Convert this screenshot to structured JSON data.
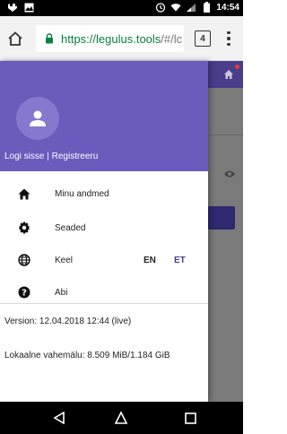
{
  "status_bar": {
    "time": "14:54",
    "left_icons": [
      "usb-icon",
      "image-icon"
    ],
    "right_icons": [
      "alarm-icon",
      "wifi-icon",
      "signal-icon",
      "battery-icon"
    ]
  },
  "browser": {
    "url_main": "https://legulus.tools",
    "url_rest": "/#/lc",
    "tab_count": "4"
  },
  "drawer": {
    "auth_text": "Logi sisse | Registreeru",
    "items": [
      {
        "label": "Minu andmed",
        "icon": "home-icon"
      },
      {
        "label": "Seaded",
        "icon": "gear-icon"
      },
      {
        "label": "Keel",
        "icon": "globe-icon"
      },
      {
        "label": "Abi",
        "icon": "help-icon"
      }
    ],
    "lang": {
      "en": "EN",
      "et": "ET"
    },
    "version": "Version: 12.04.2018 12:44 (live)",
    "cache": "Lokaalne vahemälu: 8.509 MiB/1.184 GiB"
  },
  "colors": {
    "drawer_header": "#6a5bbd",
    "active_lang": "#4a3d9a",
    "url_green": "#0b8043"
  }
}
